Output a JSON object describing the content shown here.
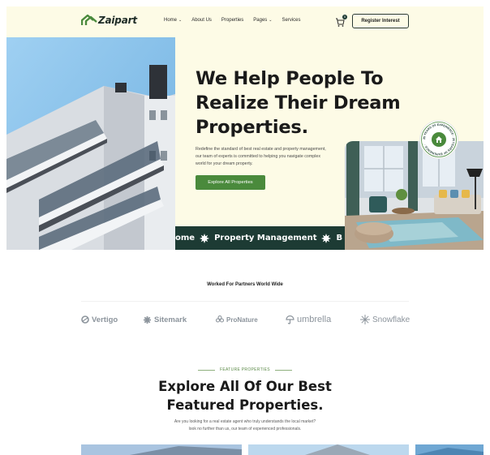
{
  "brand": {
    "name": "Zaipart"
  },
  "nav": {
    "items": [
      {
        "label": "Home",
        "dropdown": true
      },
      {
        "label": "About Us",
        "dropdown": false
      },
      {
        "label": "Properties",
        "dropdown": false
      },
      {
        "label": "Pages",
        "dropdown": true
      },
      {
        "label": "Services",
        "dropdown": false
      }
    ],
    "cart_count": "0",
    "register_label": "Register Interest"
  },
  "hero": {
    "title": "We Help People To Realize Their Dream Properties.",
    "description": "Redefine the standard of best real estate and property management, our team of experts is committed to helping you navigate complex world for your dream property.",
    "cta_label": "Explore All Properties",
    "badge_text": "25 YEARS OF EXPERIENCE · 25 YEARS OF EXPERIENCE ·",
    "ticker": [
      "ome",
      "Property Management",
      "B"
    ]
  },
  "partners": {
    "title": "Worked For Partners World Wide",
    "logos": [
      {
        "name": "Vertigo",
        "icon": "vertigo-logo"
      },
      {
        "name": "Sitemark",
        "icon": "sitemark-logo"
      },
      {
        "name": "ProNature",
        "icon": "pronature-logo"
      },
      {
        "name": "umbrella",
        "icon": "umbrella-logo"
      },
      {
        "name": "Snowflake",
        "icon": "snowflake-logo"
      }
    ]
  },
  "featured": {
    "label": "FEATURE PROPERTIES",
    "title_line1": "Explore All Of Our Best",
    "title_line2": "Featured Properties.",
    "desc_line1": "Are you looking for a real estate agent who truly understands the local market?",
    "desc_line2": "look no further than us, our team of experienced professionals."
  },
  "colors": {
    "hero_bg": "#fdfbe6",
    "accent_green": "#4a8a3c",
    "dark_green": "#1d3b34",
    "logo_gray": "#8c949c"
  }
}
